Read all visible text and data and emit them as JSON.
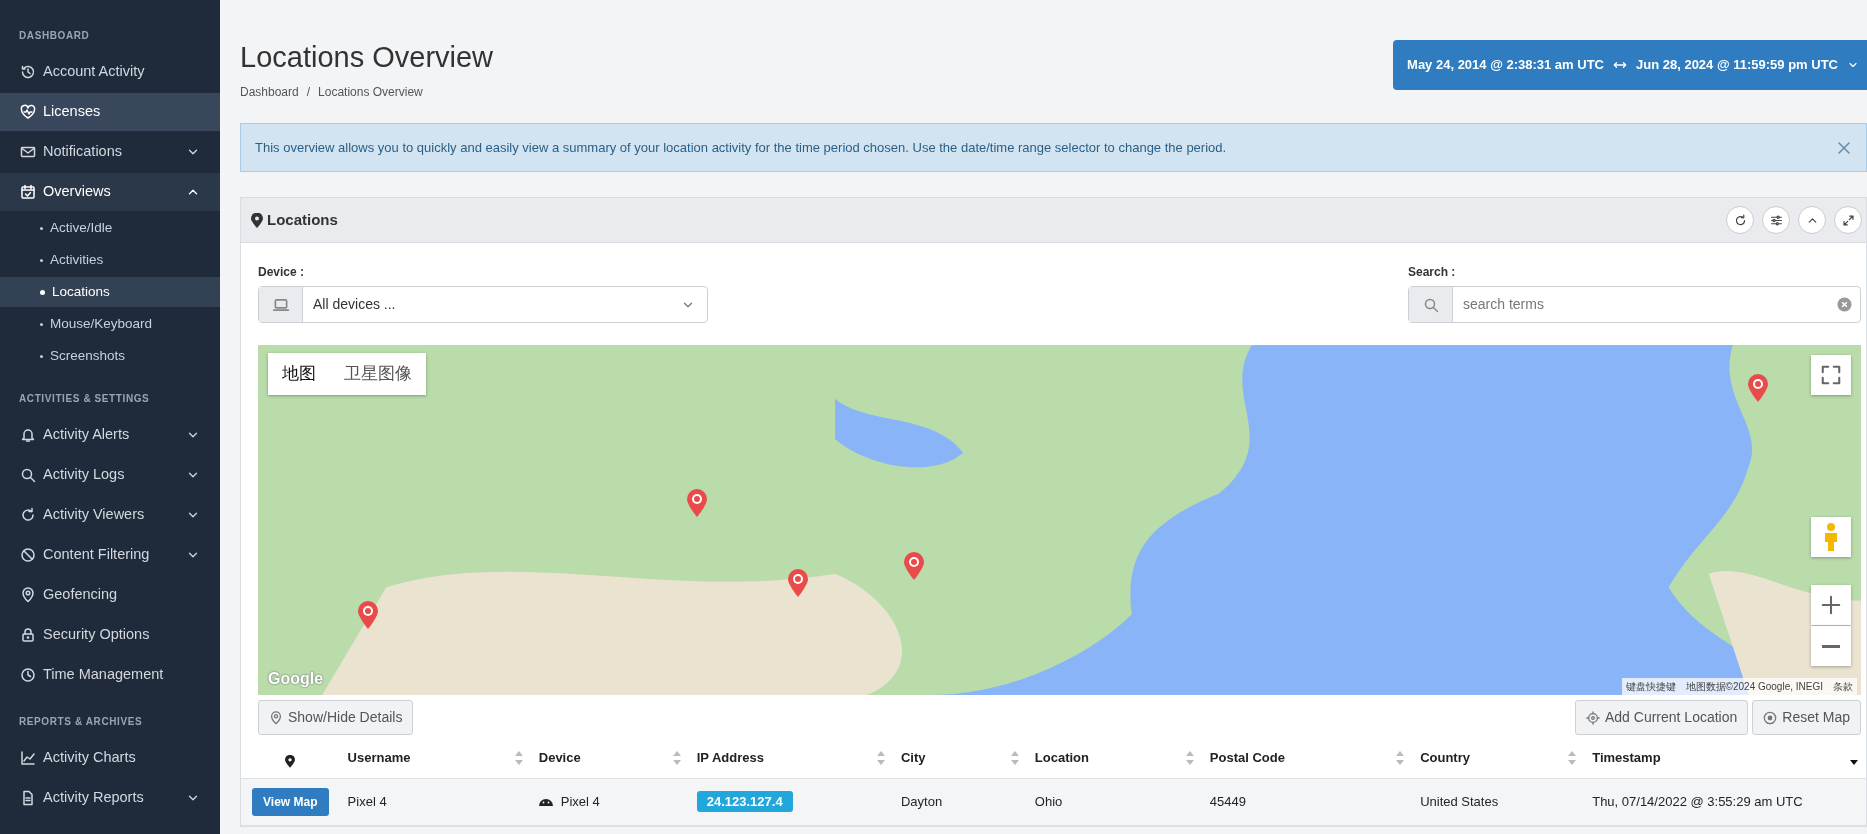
{
  "sidebar": {
    "sections": [
      {
        "heading": "DASHBOARD",
        "items": [
          {
            "label": "Account Activity",
            "selected": false
          },
          {
            "label": "Licenses",
            "selected": true
          },
          {
            "label": "Notifications",
            "selected": false,
            "expanded": false
          },
          {
            "label": "Overviews",
            "selected": false,
            "expanded": true,
            "children": [
              {
                "label": "Active/Idle",
                "selected": false
              },
              {
                "label": "Activities",
                "selected": false
              },
              {
                "label": "Locations",
                "selected": true
              },
              {
                "label": "Mouse/Keyboard",
                "selected": false
              },
              {
                "label": "Screenshots",
                "selected": false
              }
            ]
          }
        ]
      },
      {
        "heading": "ACTIVITIES & SETTINGS",
        "items": [
          {
            "label": "Activity Alerts",
            "selected": false,
            "expanded": false
          },
          {
            "label": "Activity Logs",
            "selected": false,
            "expanded": false
          },
          {
            "label": "Activity Viewers",
            "selected": false,
            "expanded": false
          },
          {
            "label": "Content Filtering",
            "selected": false,
            "expanded": false
          },
          {
            "label": "Geofencing",
            "selected": false
          },
          {
            "label": "Security Options",
            "selected": false
          },
          {
            "label": "Time Management",
            "selected": false
          }
        ]
      },
      {
        "heading": "REPORTS & ARCHIVES",
        "items": [
          {
            "label": "Activity Charts",
            "selected": false
          },
          {
            "label": "Activity Reports",
            "selected": false,
            "expanded": false
          }
        ]
      }
    ]
  },
  "page": {
    "title": "Locations Overview",
    "breadcrumb": [
      "Dashboard",
      "Locations Overview"
    ],
    "breadcrumb_separator": "/",
    "date_range": {
      "start": "May 24, 2014 @ 2:38:31 am UTC",
      "end": "Jun 28, 2024 @ 11:59:59 pm UTC"
    }
  },
  "alert": {
    "text": "This overview allows you to quickly and easily view a summary of your location activity for the time period chosen.  Use the date/time range selector to change the period."
  },
  "card": {
    "title": "Locations",
    "device": {
      "label": "Device :",
      "value": "All devices ..."
    },
    "search": {
      "label": "Search :",
      "placeholder": "search terms"
    },
    "map": {
      "types": [
        {
          "label": "地图",
          "selected": true
        },
        {
          "label": "卫星图像",
          "selected": false
        }
      ],
      "logo": "Google",
      "attribution": [
        "键盘快捷键",
        "地图数据©2024 Google, INEGI",
        "条款"
      ]
    },
    "left_buttons": [
      "Show/Hide Details"
    ],
    "right_buttons": [
      "Add Current Location",
      "Reset Map"
    ],
    "table": {
      "columns": [
        {
          "sortable": false
        },
        {
          "label": "Username",
          "sortable": true,
          "sorted_descending": false
        },
        {
          "label": "Device",
          "sortable": true,
          "sorted_descending": false
        },
        {
          "label": "IP Address",
          "sortable": true,
          "sorted_descending": false
        },
        {
          "label": "City",
          "sortable": true,
          "sorted_descending": false
        },
        {
          "label": "Location",
          "sortable": true,
          "sorted_descending": false
        },
        {
          "label": "Postal Code",
          "sortable": true,
          "sorted_descending": false
        },
        {
          "label": "Country",
          "sortable": true,
          "sorted_descending": false
        },
        {
          "label": "Timestamp",
          "sortable": true,
          "sorted_descending": true
        }
      ],
      "rows": [
        {
          "action": "View Map",
          "username": "Pixel 4",
          "device": "Pixel 4",
          "ip": "24.123.127.4",
          "city": "Dayton",
          "location": "Ohio",
          "postal_code": "45449",
          "country": "United States",
          "timestamp": "Thu, 07/14/2022 @ 3:55:29 am UTC"
        }
      ]
    }
  }
}
